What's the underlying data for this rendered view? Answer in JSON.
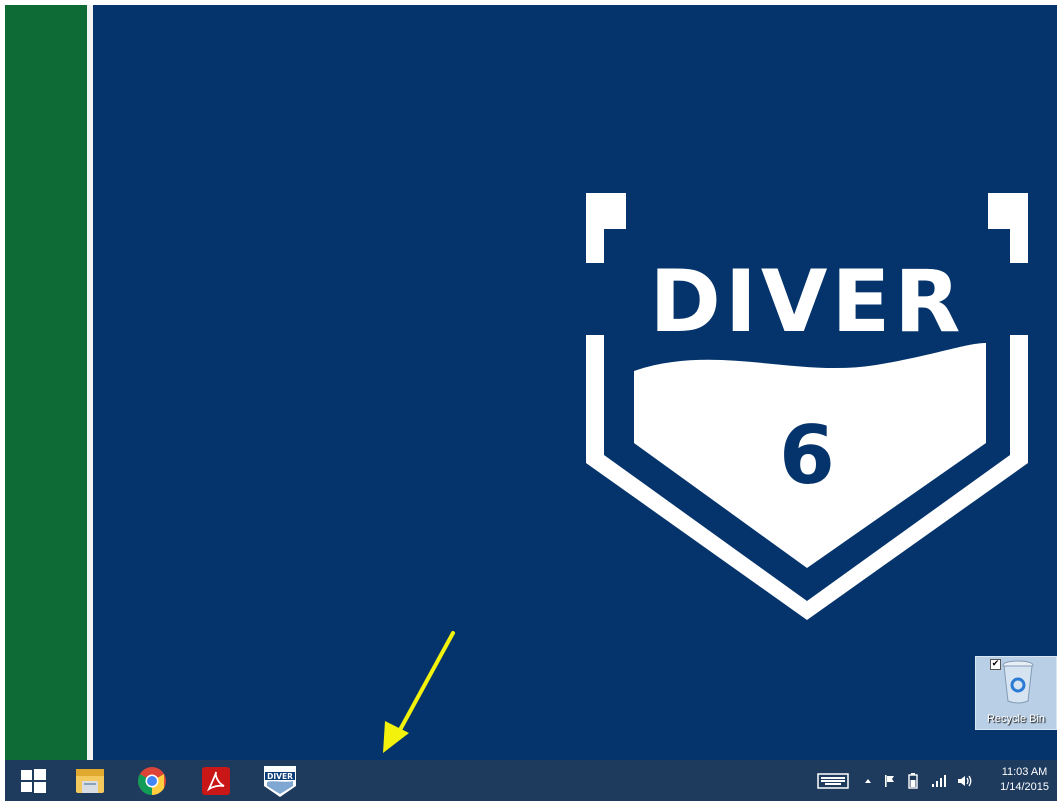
{
  "desktop": {
    "logo": {
      "word": "DIVER",
      "number": "6"
    },
    "recycle_bin": {
      "label": "Recycle Bin"
    }
  },
  "taskbar": {
    "pinned": [
      {
        "name": "File Explorer"
      },
      {
        "name": "Google Chrome"
      },
      {
        "name": "Adobe Reader"
      },
      {
        "name": "Diver 6"
      }
    ],
    "tray": {
      "time": "11:03 AM",
      "date": "1/14/2015"
    }
  },
  "colors": {
    "desktop": "#04346b",
    "left_strip": "#0e6b36",
    "taskbar": "#1e3a5d",
    "arrow": "#f2f20c"
  }
}
